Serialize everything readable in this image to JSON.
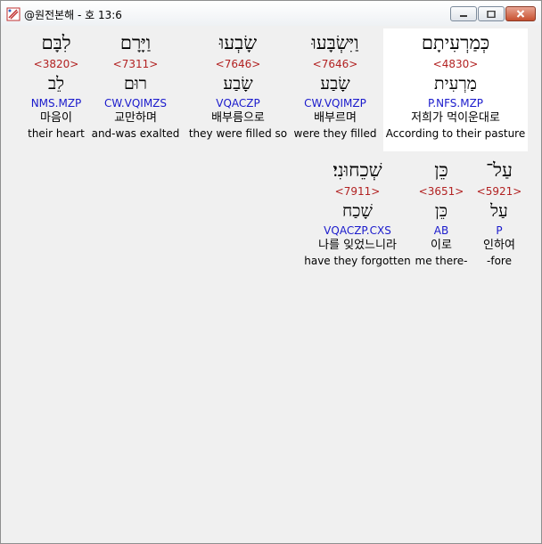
{
  "window": {
    "title": "@원전본해 - 호 13:6"
  },
  "rows": [
    {
      "words": [
        {
          "hebrew": "כְּמַרְעִיתָם",
          "strong": "<4830>",
          "lemma": "מַרְעִית",
          "morph": "P.NFS.MZP",
          "korean": "저희가 먹이운대로",
          "english": "According to their pasture",
          "highlight": true
        },
        {
          "hebrew": "וַיִּשְׂבָּעוּ",
          "strong": "<7646>",
          "lemma": "שָׂבַע",
          "morph": "CW.VQIMZP",
          "korean": "배부르며",
          "english": "were they filled",
          "highlight": false
        },
        {
          "hebrew": "שָׂבְעוּ",
          "strong": "<7646>",
          "lemma": "שָׂבַע",
          "morph": "VQACZP",
          "korean": "배부름으로",
          "english": "they were filled so",
          "highlight": false
        },
        {
          "hebrew": "וַיָּרָם",
          "strong": "<7311>",
          "lemma": "רוּם",
          "morph": "CW.VQIMZS",
          "korean": "교만하며",
          "english": "and-was exalted",
          "highlight": false
        },
        {
          "hebrew": "לִבָּם",
          "strong": "<3820>",
          "lemma": "לֵב",
          "morph": "NMS.MZP",
          "korean": "마음이",
          "english": "their heart",
          "highlight": false
        }
      ]
    },
    {
      "words": [
        {
          "hebrew": "עַל־",
          "strong": "<5921>",
          "lemma": "עַל",
          "morph": "P",
          "korean": "인하여",
          "english": "-fore",
          "highlight": false
        },
        {
          "hebrew": "כֵּן",
          "strong": "<3651>",
          "lemma": "כֵּן",
          "morph": "AB",
          "korean": "이로",
          "english": "me there-",
          "highlight": false
        },
        {
          "hebrew": "שְׁכֵחוּנִי׃",
          "strong": "<7911>",
          "lemma": "שָׁכַח",
          "morph": "VQACZP.CXS",
          "korean": "나를 잊었느니라",
          "english": "have they forgotten",
          "highlight": false
        }
      ]
    }
  ]
}
